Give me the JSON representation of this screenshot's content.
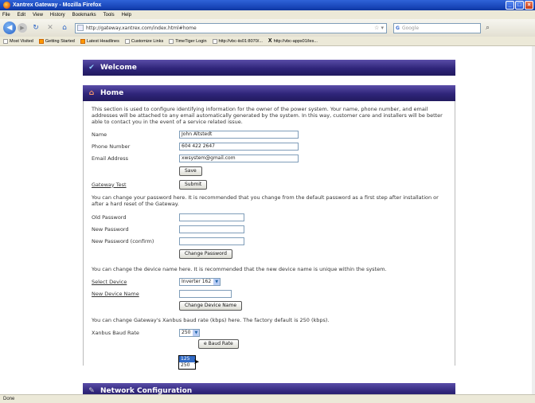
{
  "window": {
    "title": "Xantrex Gateway - Mozilla Firefox"
  },
  "menu": [
    "File",
    "Edit",
    "View",
    "History",
    "Bookmarks",
    "Tools",
    "Help"
  ],
  "nav": {
    "url": "http://gateway.xantrex.com/index.html#home",
    "search_placeholder": "Google"
  },
  "bookmarks": [
    "Most Visited",
    "Getting Started",
    "Latest Headlines",
    "Customize Links",
    "TimeTiger Login",
    "http://vbc-iis01:8070/...",
    "http://vbc-apps01/les..."
  ],
  "sections": {
    "welcome": "Welcome",
    "home": "Home",
    "network": "Network Configuration"
  },
  "home": {
    "intro": "This section is used to configure identifying information for the owner of the power system. Your name, phone number, and email addresses will be attached to any email automatically generated by the system. In this way, customer care and installers will be better able to contact you in the event of a service related issue.",
    "name_label": "Name",
    "name_value": "John Altstedt",
    "phone_label": "Phone Number",
    "phone_value": "604 422 2647",
    "email_label": "Email Address",
    "email_value": "xwsystem@gmail.com",
    "save_button": "Save",
    "gateway_test_label": "Gateway Test",
    "submit_button": "Submit",
    "password_intro": "You can change your password here. It is recommended that you change from the default password as a first step after installation or after a hard reset of the Gateway.",
    "old_password_label": "Old Password",
    "new_password_label": "New Password",
    "confirm_password_label": "New Password (confirm)",
    "change_password_button": "Change Password",
    "device_intro": "You can change the device name here. It is recommended that the new device name is unique within the system.",
    "select_device_label": "Select Device",
    "select_device_value": "Inverter 162",
    "new_device_name_label": "New Device Name",
    "change_device_name_button": "Change Device Name",
    "baud_intro": "You can change Gateway's Xanbus baud rate (kbps) here. The factory default is 250 (kbps).",
    "baud_label": "Xanbus Baud Rate",
    "baud_value": "250",
    "baud_options": [
      "125",
      "250"
    ],
    "baud_button_visible": "e Baud Rate"
  },
  "status": "Done"
}
